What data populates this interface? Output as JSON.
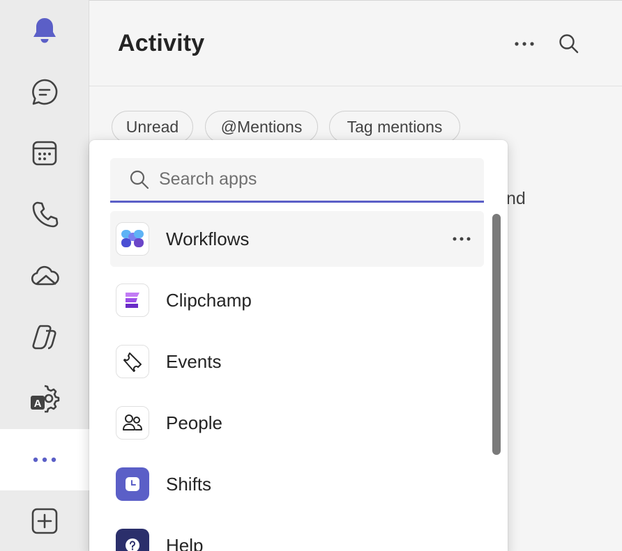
{
  "header": {
    "title": "Activity"
  },
  "filters": [
    {
      "label": "Unread"
    },
    {
      "label": "@Mentions"
    },
    {
      "label": "Tag mentions"
    }
  ],
  "background_partial_text": "nd",
  "flyout": {
    "search": {
      "placeholder": "Search apps",
      "value": ""
    },
    "apps": [
      {
        "label": "Workflows",
        "icon": "workflows-icon"
      },
      {
        "label": "Clipchamp",
        "icon": "clipchamp-icon"
      },
      {
        "label": "Events",
        "icon": "ticket-icon"
      },
      {
        "label": "People",
        "icon": "people-icon"
      },
      {
        "label": "Shifts",
        "icon": "clock-icon"
      },
      {
        "label": "Help",
        "icon": "help-icon"
      }
    ]
  },
  "rail": {
    "items": [
      {
        "icon": "bell-icon"
      },
      {
        "icon": "chat-icon"
      },
      {
        "icon": "calendar-icon"
      },
      {
        "icon": "phone-icon"
      },
      {
        "icon": "cloud-icon"
      },
      {
        "icon": "copilot-icon"
      },
      {
        "icon": "settings-translate-icon"
      },
      {
        "icon": "more-apps-icon"
      },
      {
        "icon": "add-app-icon"
      }
    ]
  },
  "colors": {
    "accent": "#5b5fc7",
    "rail_bg": "#ebebeb",
    "panel_bg": "#f5f5f5"
  }
}
